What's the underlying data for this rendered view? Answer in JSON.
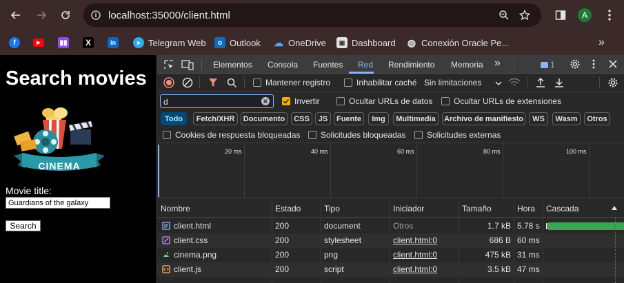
{
  "browser": {
    "url": "localhost:35000/client.html",
    "profile_initial": "A",
    "bookmarks": [
      {
        "label": "",
        "icon": "facebook-icon",
        "color": "#1877f2"
      },
      {
        "label": "",
        "icon": "youtube-icon",
        "color": "#ff0000"
      },
      {
        "label": "",
        "icon": "twitch-icon",
        "color": "#9146ff"
      },
      {
        "label": "",
        "icon": "x-icon",
        "color": "#000000"
      },
      {
        "label": "",
        "icon": "linkedin-icon",
        "color": "#0a66c2"
      },
      {
        "label": "Telegram Web",
        "icon": "telegram-icon",
        "color": "#2aabee"
      },
      {
        "label": "Outlook",
        "icon": "outlook-icon",
        "color": "#0f6cbd"
      },
      {
        "label": "OneDrive",
        "icon": "onedrive-icon",
        "color": "#0364b8"
      },
      {
        "label": "Dashboard",
        "icon": "dashboard-icon",
        "color": "#e3e3e3"
      },
      {
        "label": "Conexión Oracle Pe...",
        "icon": "globe-icon",
        "color": "#e3e3e3"
      }
    ],
    "more_bookmarks": "»"
  },
  "page": {
    "title": "Search movies",
    "logo_text": "CINEMA",
    "movie_label": "Movie title:",
    "movie_value": "Guardians of the galaxy",
    "search_button": "Search"
  },
  "devtools": {
    "tabs": [
      "Elementos",
      "Consola",
      "Fuentes",
      "Red",
      "Rendimiento",
      "Memoria"
    ],
    "active_tab": "Red",
    "more_tabs": "»",
    "messages_count": "1",
    "toolbar": {
      "preserve_log": "Mantener registro",
      "disable_cache": "Inhabilitar caché",
      "throttling": "Sin limitaciones"
    },
    "filter": {
      "value": "d",
      "invert": "Invertir",
      "hide_data_urls": "Ocultar URLs de datos",
      "hide_extension_urls": "Ocultar URLs de extensiones"
    },
    "type_filters": [
      "Todo",
      "Fetch/XHR",
      "Documento",
      "CSS",
      "JS",
      "Fuente",
      "Img",
      "Multimedia",
      "Archivo de manifiesto",
      "WS",
      "Wasm",
      "Otros"
    ],
    "blocked": {
      "blocked_cookies": "Cookies de respuesta bloqueadas",
      "blocked_requests": "Solicitudes bloqueadas",
      "third_party": "Solicitudes externas"
    },
    "timeline_ticks": [
      "20 ms",
      "40 ms",
      "60 ms",
      "80 ms",
      "100 ms"
    ],
    "columns": [
      "Nombre",
      "Estado",
      "Tipo",
      "Iniciador",
      "Tamaño",
      "Hora",
      "Cascada"
    ],
    "rows": [
      {
        "name": "client.html",
        "icon": "document-icon",
        "status": "200",
        "type": "document",
        "initiator": "Otros",
        "size": "1.7 kB",
        "time": "5.78 s"
      },
      {
        "name": "client.css",
        "icon": "stylesheet-icon",
        "status": "200",
        "type": "stylesheet",
        "initiator": "client.html:0",
        "size": "686 B",
        "time": "60 ms"
      },
      {
        "name": "cinema.png",
        "icon": "image-icon",
        "status": "200",
        "type": "png",
        "initiator": "client.html:0",
        "size": "475 kB",
        "time": "31 ms"
      },
      {
        "name": "client.js",
        "icon": "script-icon",
        "status": "200",
        "type": "script",
        "initiator": "client.html:0",
        "size": "3.5 kB",
        "time": "47 ms"
      }
    ]
  }
}
